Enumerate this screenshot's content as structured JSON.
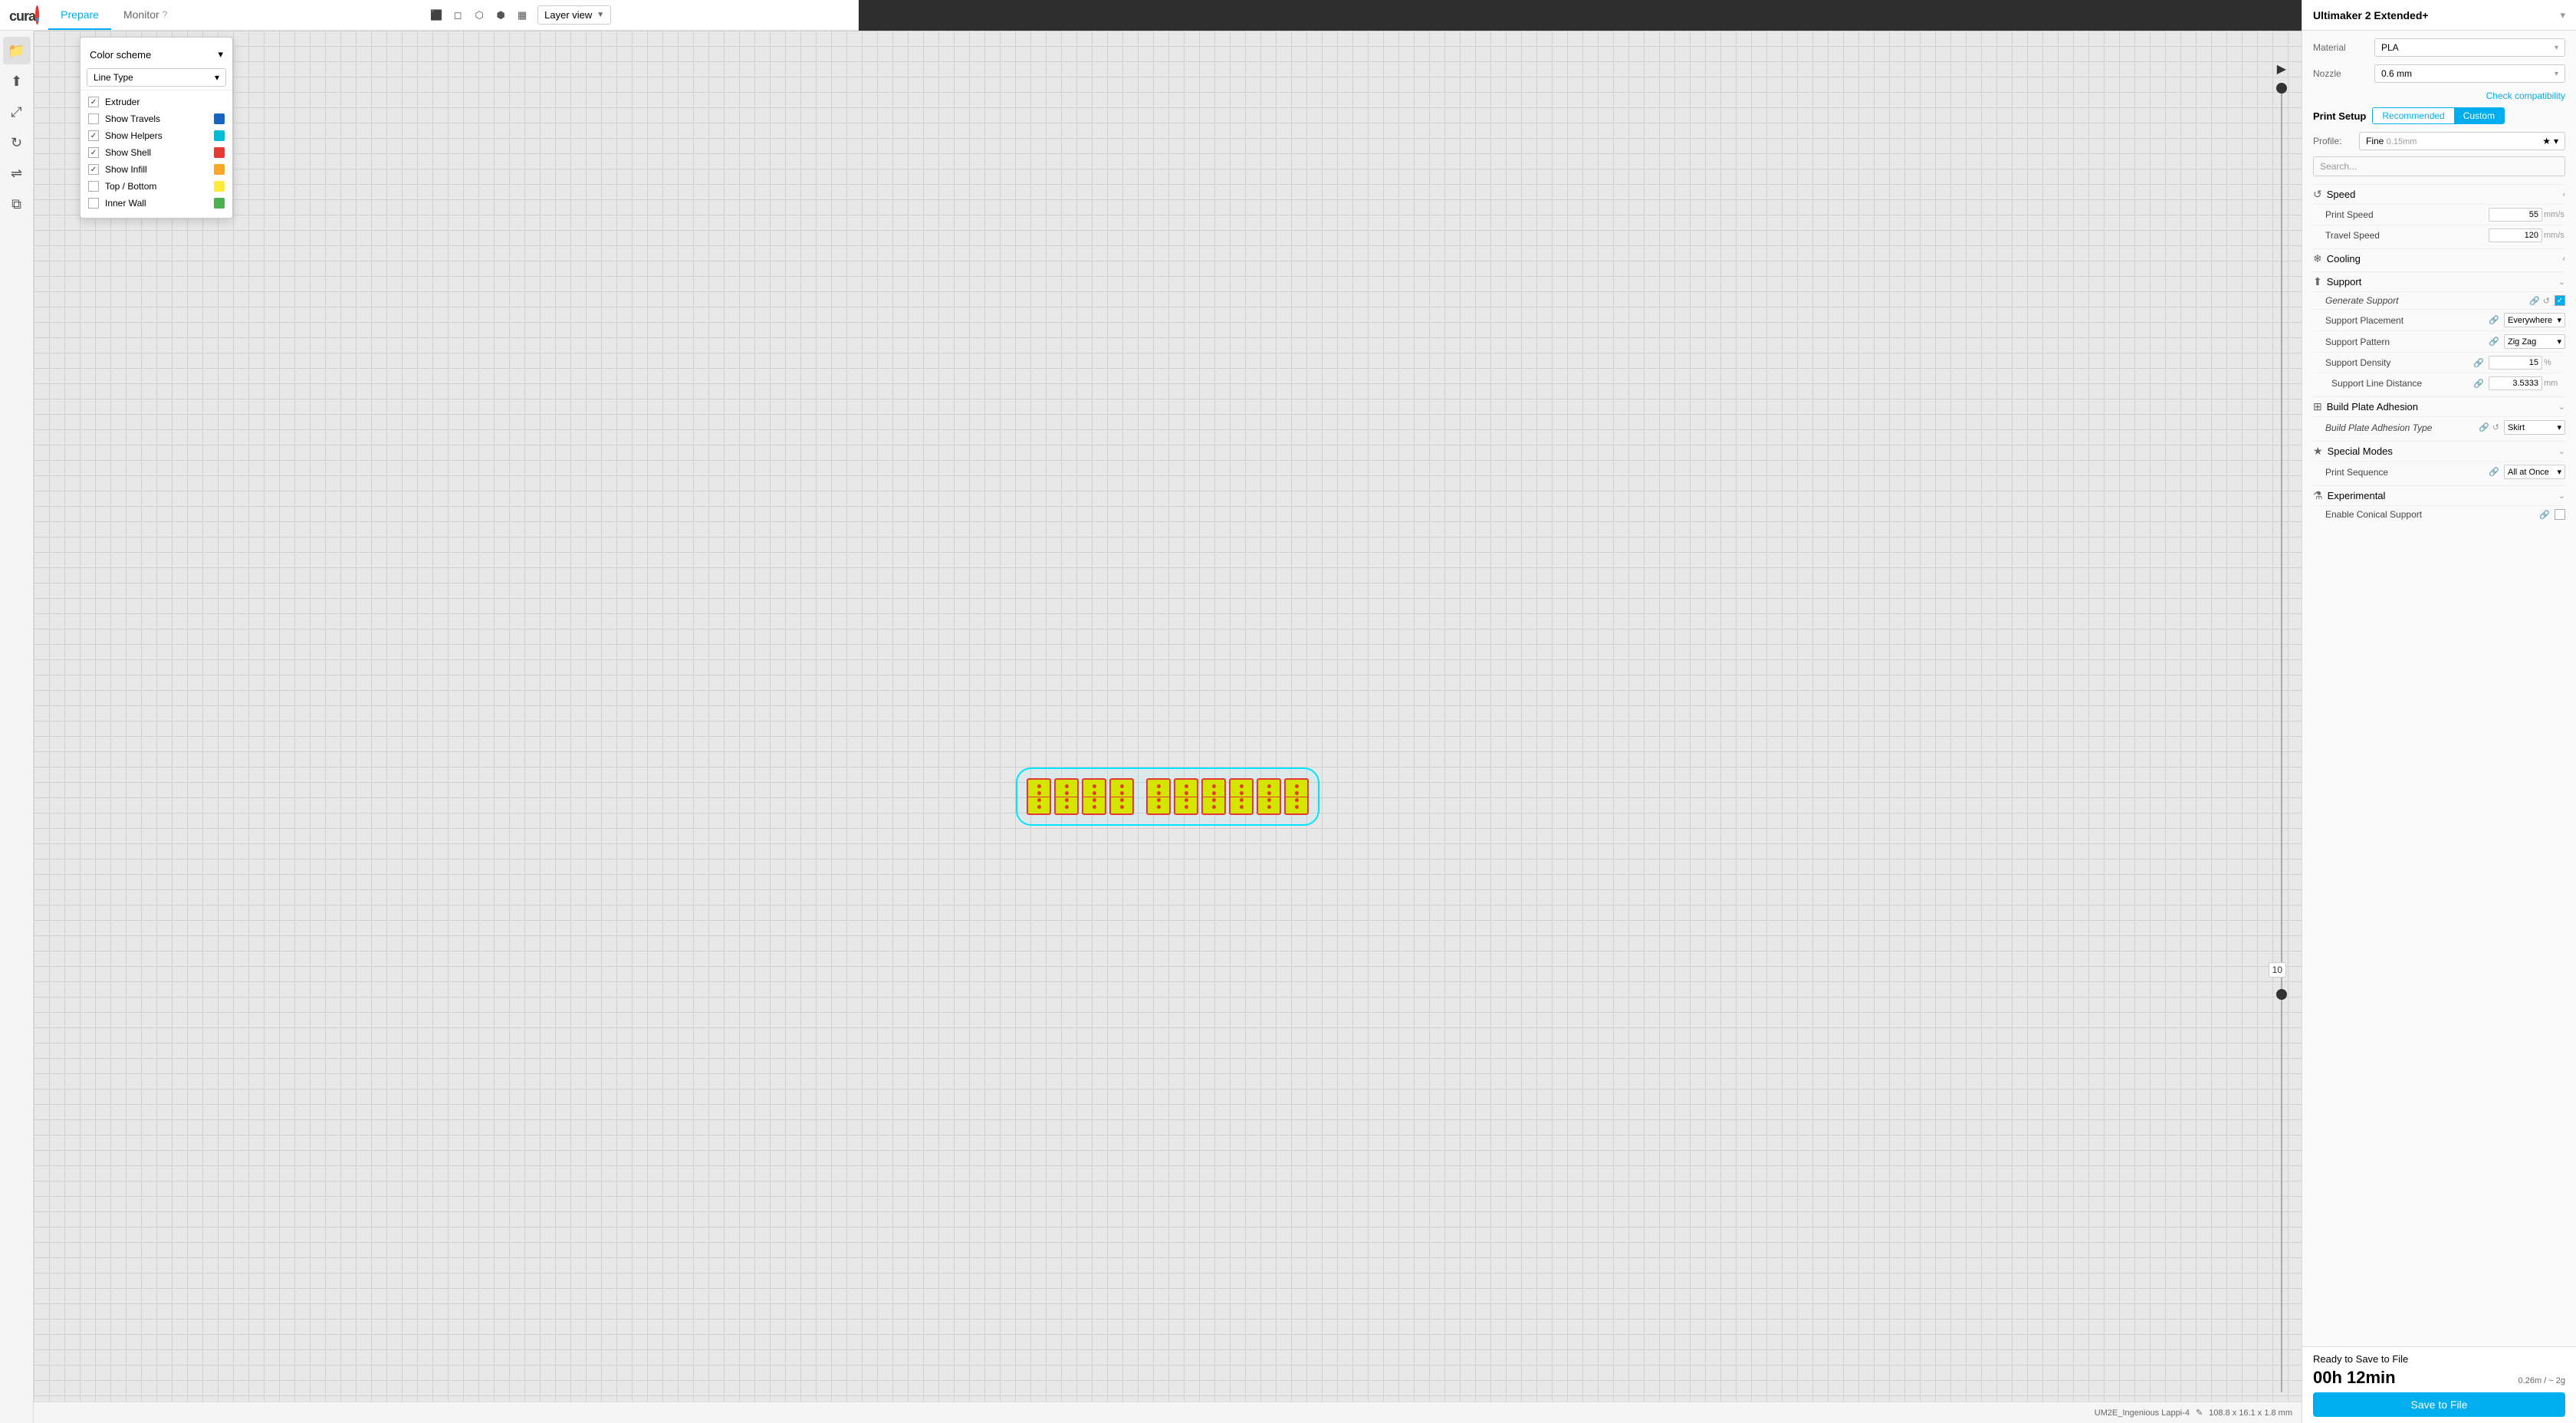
{
  "app": {
    "logo": "cura",
    "logo_dot": ".",
    "nav": {
      "tabs": [
        {
          "label": "Prepare",
          "active": true
        },
        {
          "label": "Monitor",
          "active": false,
          "has_help": true
        }
      ]
    },
    "view_icons": [
      "cube-solid",
      "cube-wire",
      "cube-x",
      "cube-multi",
      "cube-layers"
    ],
    "view_dropdown": {
      "label": "Layer view",
      "arrow": "▼"
    }
  },
  "color_scheme": {
    "title": "Color scheme",
    "title_arrow": "▾",
    "line_type_label": "Line Type",
    "line_type_arrow": "▾",
    "items": [
      {
        "label": "Extruder",
        "checked": true,
        "color": null
      },
      {
        "label": "Show Travels",
        "checked": false,
        "color": "#1565c0"
      },
      {
        "label": "Show Helpers",
        "checked": true,
        "color": "#00bcd4"
      },
      {
        "label": "Show Shell",
        "checked": true,
        "color": "#e53935"
      },
      {
        "label": "Show Infill",
        "checked": true,
        "color": "#f9a825"
      },
      {
        "label": "Top / Bottom",
        "checked": false,
        "color": "#ffeb3b"
      },
      {
        "label": "Inner Wall",
        "checked": false,
        "color": "#4caf50"
      }
    ]
  },
  "right_panel": {
    "title": "Ultimaker 2 Extended+",
    "collapse_arrow": "▾",
    "material_label": "Material",
    "material_value": "PLA",
    "nozzle_label": "Nozzle",
    "nozzle_value": "0.6 mm",
    "check_compat": "Check compatibility",
    "print_setup_label": "Print Setup",
    "setup_tabs": [
      {
        "label": "Recommended",
        "active": false
      },
      {
        "label": "Custom",
        "active": true
      }
    ],
    "profile_label": "Profile:",
    "profile_value": "Fine",
    "profile_sub": "0.15mm",
    "search_placeholder": "Search...",
    "sections": [
      {
        "id": "speed",
        "icon": "⟳",
        "title": "Speed",
        "collapsed": true,
        "settings": [
          {
            "label": "Print Speed",
            "value": "55",
            "unit": "mm/s"
          },
          {
            "label": "Travel Speed",
            "value": "120",
            "unit": "mm/s"
          }
        ]
      },
      {
        "id": "cooling",
        "icon": "❄",
        "title": "Cooling",
        "collapsed": true,
        "settings": []
      },
      {
        "id": "support",
        "icon": "⬆",
        "title": "Support",
        "collapsed": false,
        "settings": [
          {
            "label": "Generate Support",
            "type": "checkbox",
            "checked": true,
            "italic": true
          },
          {
            "label": "Support Placement",
            "type": "select",
            "value": "Everywhere"
          },
          {
            "label": "Support Pattern",
            "type": "select",
            "value": "Zig Zag"
          },
          {
            "label": "Support Density",
            "type": "number",
            "value": "15",
            "unit": "%"
          },
          {
            "label": "Support Line Distance",
            "type": "number",
            "value": "3.5333",
            "unit": "mm",
            "indent": true
          }
        ]
      },
      {
        "id": "build-plate",
        "icon": "⊞",
        "title": "Build Plate Adhesion",
        "collapsed": false,
        "settings": [
          {
            "label": "Build Plate Adhesion Type",
            "type": "select",
            "value": "Skirt",
            "italic": true
          }
        ]
      },
      {
        "id": "special",
        "icon": "★",
        "title": "Special Modes",
        "collapsed": false,
        "settings": [
          {
            "label": "Print Sequence",
            "type": "select",
            "value": "All at Once"
          }
        ]
      },
      {
        "id": "experimental",
        "icon": "⚗",
        "title": "Experimental",
        "collapsed": false,
        "settings": [
          {
            "label": "Enable Conical Support",
            "type": "checkbox",
            "checked": false
          }
        ]
      }
    ],
    "bottom": {
      "ready_label": "Ready to Save to File",
      "time": "00h 12min",
      "meta": "0.26m / ~ 2g",
      "save_button": "Save to File"
    }
  },
  "status_bar": {
    "model": "UM2E_Ingenious Lappi-4",
    "dimensions": "108.8 x 16.1 x 1.8 mm"
  },
  "layer_slider": {
    "number": "10"
  }
}
